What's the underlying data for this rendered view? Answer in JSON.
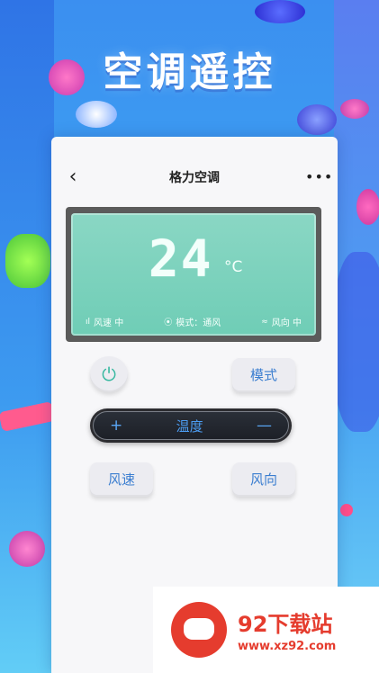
{
  "banner": {
    "title": "空调遥控"
  },
  "nav": {
    "back": "‹",
    "title": "格力空调",
    "more": "•••"
  },
  "display": {
    "temperature": "24",
    "unit": "°C",
    "status": [
      {
        "icon": "signal-bars-icon",
        "glyph": "ıl",
        "label": "风速 中"
      },
      {
        "icon": "mode-icon",
        "glyph": "⦿",
        "label": "模式：通风"
      },
      {
        "icon": "wind-icon",
        "glyph": "≈",
        "label": "风向 中"
      }
    ]
  },
  "controls": {
    "power_glyph": "⏻",
    "mode_label": "模式",
    "temp_label": "温度",
    "temp_plus": "+",
    "temp_minus": "—",
    "wind_speed_label": "风速",
    "wind_direction_label": "风向"
  },
  "watermark": {
    "name": "92下载站",
    "url": "www.xz92.com"
  },
  "colors": {
    "accent": "#3b7ed0",
    "display_green": "#7bd3bd",
    "watermark_red": "#e53c2e"
  }
}
